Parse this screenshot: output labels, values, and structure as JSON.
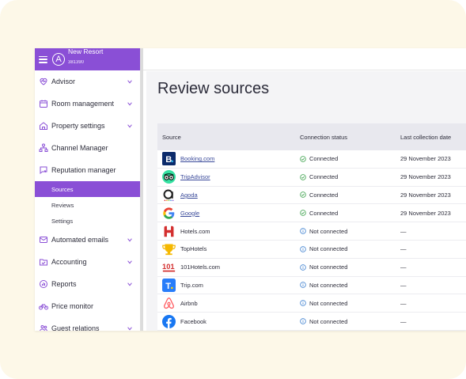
{
  "brand": {
    "name": "New Resort",
    "id": "381390",
    "avatar": "A",
    "color": "#8a4fd6"
  },
  "sidebar": {
    "items": [
      {
        "label": "Advisor",
        "icon": "heart-pulse-icon",
        "chevron": true
      },
      {
        "label": "Room management",
        "icon": "calendar-icon",
        "chevron": true
      },
      {
        "label": "Property settings",
        "icon": "house-icon",
        "chevron": true
      },
      {
        "label": "Channel Manager",
        "icon": "network-icon",
        "chevron": false
      },
      {
        "label": "Reputation manager",
        "icon": "chat-bubble-icon",
        "chevron": false
      }
    ],
    "subitems": [
      {
        "label": "Sources",
        "active": true
      },
      {
        "label": "Reviews",
        "active": false
      },
      {
        "label": "Settings",
        "active": false
      }
    ],
    "items_after": [
      {
        "label": "Automated emails",
        "icon": "envelope-icon",
        "chevron": true
      },
      {
        "label": "Accounting",
        "icon": "folder-check-icon",
        "chevron": true
      },
      {
        "label": "Reports",
        "icon": "chart-icon",
        "chevron": true
      },
      {
        "label": "Price monitor",
        "icon": "bike-icon",
        "chevron": false
      },
      {
        "label": "Guest relations",
        "icon": "people-icon",
        "chevron": true
      }
    ]
  },
  "main": {
    "title": "Review sources",
    "columns": [
      "Source",
      "Connection status",
      "Last collection date"
    ],
    "rows": [
      {
        "source": "Booking.com",
        "logo": "booking-logo",
        "linked": true,
        "status": "Connected",
        "date": "29 November 2023"
      },
      {
        "source": "TripAdvisor",
        "logo": "tripadvisor-logo",
        "linked": true,
        "status": "Connected",
        "date": "29 November 2023"
      },
      {
        "source": "Agoda",
        "logo": "agoda-logo",
        "linked": true,
        "status": "Connected",
        "date": "29 November 2023"
      },
      {
        "source": "Google",
        "logo": "google-logo",
        "linked": true,
        "status": "Connected",
        "date": "29 November 2023"
      },
      {
        "source": "Hotels.com",
        "logo": "hotels-logo",
        "linked": false,
        "status": "Not connected",
        "date": "—"
      },
      {
        "source": "TopHotels",
        "logo": "tophotels-logo",
        "linked": false,
        "status": "Not connected",
        "date": "—"
      },
      {
        "source": "101Hotels.com",
        "logo": "101hotels-logo",
        "linked": false,
        "status": "Not connected",
        "date": "—"
      },
      {
        "source": "Trip.com",
        "logo": "trip-logo",
        "linked": false,
        "status": "Not connected",
        "date": "—"
      },
      {
        "source": "Airbnb",
        "logo": "airbnb-logo",
        "linked": false,
        "status": "Not connected",
        "date": "—"
      },
      {
        "source": "Facebook",
        "logo": "facebook-logo",
        "linked": false,
        "status": "Not connected",
        "date": "—"
      }
    ]
  },
  "colors": {
    "connected": "#3aa14a",
    "not_connected": "#3a7ecf",
    "accent": "#8a4fd6"
  }
}
